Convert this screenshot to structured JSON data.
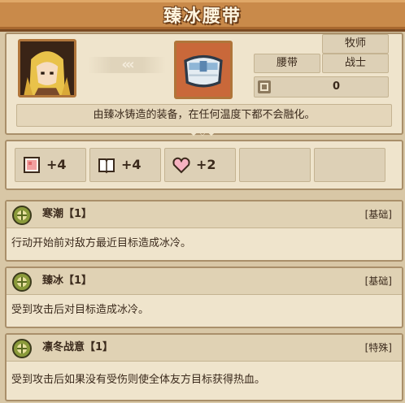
{
  "title": "臻冰腰带",
  "item": {
    "tags": [
      "牧师",
      "腰带",
      "战士"
    ],
    "level": "0",
    "description": "由臻冰铸造的装备，在任何温度下都不会融化。"
  },
  "stats": [
    {
      "icon": "fist-icon",
      "value": "+4"
    },
    {
      "icon": "book-icon",
      "value": "+4"
    },
    {
      "icon": "heart-icon",
      "value": "+2"
    }
  ],
  "skills": [
    {
      "name": "寒潮【1】",
      "type": "[基础]",
      "desc": "行动开始前对敌方最近目标造成冰冷。"
    },
    {
      "name": "臻冰【1】",
      "type": "[基础]",
      "desc": "受到攻击后对目标造成冰冷。"
    },
    {
      "name": "凛冬战意【1】",
      "type": "[特殊]",
      "desc": "受到攻击后如果没有受伤则使全体友方目标获得热血。"
    }
  ],
  "colors": {
    "title_bar": "#c98a4a",
    "panel_bg": "#efe4cc",
    "accent_gold": "#b0753a"
  }
}
